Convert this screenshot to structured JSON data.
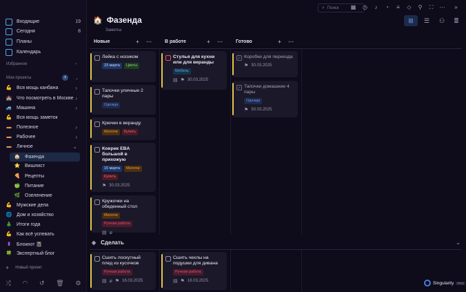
{
  "sidebar": {
    "nav": [
      {
        "label": "Входящие",
        "count": "19",
        "icon": "inbox-icon",
        "glyph": "▣",
        "color": "#5aa7e8"
      },
      {
        "label": "Сегодня",
        "count": "8",
        "icon": "calendar-today-icon",
        "glyph": "▦",
        "color": "#5aa7e8"
      },
      {
        "label": "Планы",
        "count": "",
        "icon": "plans-icon",
        "glyph": "▤",
        "color": "#5aa7e8"
      },
      {
        "label": "Календарь",
        "count": "",
        "icon": "calendar-icon",
        "glyph": "▥",
        "color": "#5aa7e8"
      }
    ],
    "favorites_label": "Избранное",
    "projects_label": "Мои проекты",
    "projects": [
      {
        "label": "Вся мощь канбана",
        "icon": "flex-icon",
        "glyph": "💪",
        "chev": true,
        "sub": false
      },
      {
        "label": "Что посмотреть в Москве",
        "icon": "kremlin-icon",
        "glyph": "🏰",
        "chev": true,
        "sub": false
      },
      {
        "label": "Машина",
        "icon": "car-icon",
        "glyph": "🚙",
        "chev": true,
        "sub": false
      },
      {
        "label": "Вся мощь заметок",
        "icon": "flex-icon",
        "glyph": "💪",
        "chev": false,
        "sub": false
      },
      {
        "label": "Полезное",
        "icon": "folder-icon",
        "glyph": "▬",
        "chev": true,
        "sub": false
      },
      {
        "label": "Рабочее",
        "icon": "folder-icon",
        "glyph": "▬",
        "chev": true,
        "sub": false
      },
      {
        "label": "Личное",
        "icon": "folder-icon",
        "glyph": "▬",
        "chev": true,
        "sub": false
      },
      {
        "label": "Фазенда",
        "icon": "house-icon",
        "glyph": "🏠",
        "chev": false,
        "sub": true,
        "active": true
      },
      {
        "label": "Вишлист",
        "icon": "star-icon",
        "glyph": "⭐",
        "chev": false,
        "sub": true
      },
      {
        "label": "Рецепты",
        "icon": "pizza-icon",
        "glyph": "🍕",
        "chev": false,
        "sub": true
      },
      {
        "label": "Питание",
        "icon": "apple-icon",
        "glyph": "🍏",
        "chev": false,
        "sub": true
      },
      {
        "label": "Озеленение",
        "icon": "plant-icon",
        "glyph": "🌿",
        "chev": false,
        "sub": true
      },
      {
        "label": "Мужские дела",
        "icon": "flex-icon",
        "glyph": "💪",
        "chev": false,
        "sub": false
      },
      {
        "label": "Дом и хозяйство",
        "icon": "globe-icon",
        "glyph": "🌐",
        "chev": false,
        "sub": false
      },
      {
        "label": "Итоги года",
        "icon": "tree-icon",
        "glyph": "🎄",
        "chev": false,
        "sub": false
      },
      {
        "label": "Как всё успевать",
        "icon": "flex-icon",
        "glyph": "💪",
        "chev": false,
        "sub": false
      },
      {
        "label": "Блокнот 📓",
        "icon": "notebook-icon",
        "glyph": "▮",
        "chev": false,
        "sub": false
      },
      {
        "label": "Экспертный блог",
        "icon": "clover-icon",
        "glyph": "🍀",
        "chev": false,
        "sub": false
      }
    ],
    "new_project": "Новый проект"
  },
  "topbar": {
    "search_placeholder": "Поиск"
  },
  "page": {
    "title": "Фазенда",
    "subtitle": "Заметка"
  },
  "columns": [
    {
      "label": "Новые"
    },
    {
      "label": "В работе"
    },
    {
      "label": "Готово"
    }
  ],
  "cards": {
    "c1": {
      "title": "Лейка с носиком",
      "tags": [
        {
          "t": "23 марта",
          "style": "date"
        },
        {
          "t": "Цветы",
          "style": "green"
        }
      ]
    },
    "c2": {
      "title": "Тапочки уличные 2 пары",
      "tags": [
        {
          "t": "Одежда",
          "style": "blue"
        }
      ]
    },
    "c3": {
      "title": "Крючки в веранду",
      "tags": [
        {
          "t": "Мелочи",
          "style": "orange"
        },
        {
          "t": "Купить",
          "style": "red"
        }
      ]
    },
    "c4": {
      "title": "Коврик EBA большой в прихожую",
      "tags": [
        {
          "t": "15 марта",
          "style": "date"
        },
        {
          "t": "Мелочи",
          "style": "orange"
        },
        {
          "t": "Купить",
          "style": "red"
        }
      ],
      "date": "30.03.2025"
    },
    "c5": {
      "title": "Кружочки на обеденный стол",
      "tags": [
        {
          "t": "Мелочи",
          "style": "orange"
        },
        {
          "t": "Ручная работа",
          "style": "pink"
        }
      ]
    },
    "c6": {
      "title": "Стулья для кухни или для веранды",
      "tags": [
        {
          "t": "Мебель",
          "style": "teal"
        }
      ],
      "date": "30.03.2025"
    },
    "c7": {
      "title": "Коробки для переезда",
      "date": "30.03.2025"
    },
    "c8": {
      "title": "Тапочки домашние 4 пары",
      "tags": [
        {
          "t": "Одежда",
          "style": "blue"
        }
      ],
      "date": "30.03.2025"
    },
    "c9": {
      "title": "Сшить лоскутный плед из кусочков",
      "tags": [
        {
          "t": "Ручная работа",
          "style": "pink"
        }
      ],
      "date": "16.03.2025"
    },
    "c10": {
      "title": "Сшить чехлы на подушки для дивана",
      "tags": [
        {
          "t": "Ручная работа",
          "style": "pink"
        }
      ],
      "date": "16.03.2025"
    }
  },
  "group": {
    "label": "Сделать"
  },
  "brand": {
    "name": "Singularity",
    "badge": "PRO"
  },
  "tag_styles": {
    "date": {
      "bg": "#1d3566",
      "fg": "#cfdcff"
    },
    "green": {
      "bg": "#1f3a22",
      "fg": "#7bcf78"
    },
    "blue": {
      "bg": "#1e2a4c",
      "fg": "#6f8fe0"
    },
    "orange": {
      "bg": "#4a2f12",
      "fg": "#e89a3a"
    },
    "red": {
      "bg": "#4a1a25",
      "fg": "#e46479"
    },
    "pink": {
      "bg": "#4a1a2c",
      "fg": "#d85478"
    },
    "teal": {
      "bg": "#16344a",
      "fg": "#5fa8d8"
    }
  }
}
